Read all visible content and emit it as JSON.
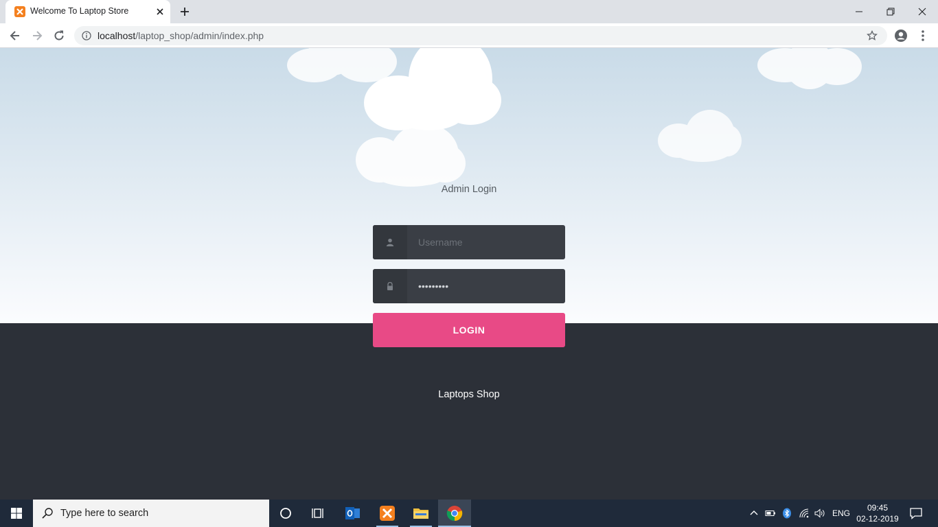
{
  "browser": {
    "tab_title": "Welcome To Laptop Store",
    "url_host": "localhost",
    "url_path": "/laptop_shop/admin/index.php"
  },
  "login": {
    "heading": "Admin Login",
    "username_placeholder": "Username",
    "password_value": "•••••••••",
    "login_label": "LOGIN"
  },
  "footer": {
    "text": "Laptops Shop"
  },
  "taskbar": {
    "search_placeholder": "Type here to search",
    "language": "ENG",
    "time": "09:45",
    "date": "02-12-2019",
    "apps": [
      "cortana-icon",
      "task-view-icon",
      "outlook-icon",
      "xampp-icon",
      "file-explorer-icon",
      "chrome-icon"
    ]
  },
  "colors": {
    "accent": "#e84a86",
    "field_bg": "#3a3e45",
    "ground": "#2c3038"
  }
}
